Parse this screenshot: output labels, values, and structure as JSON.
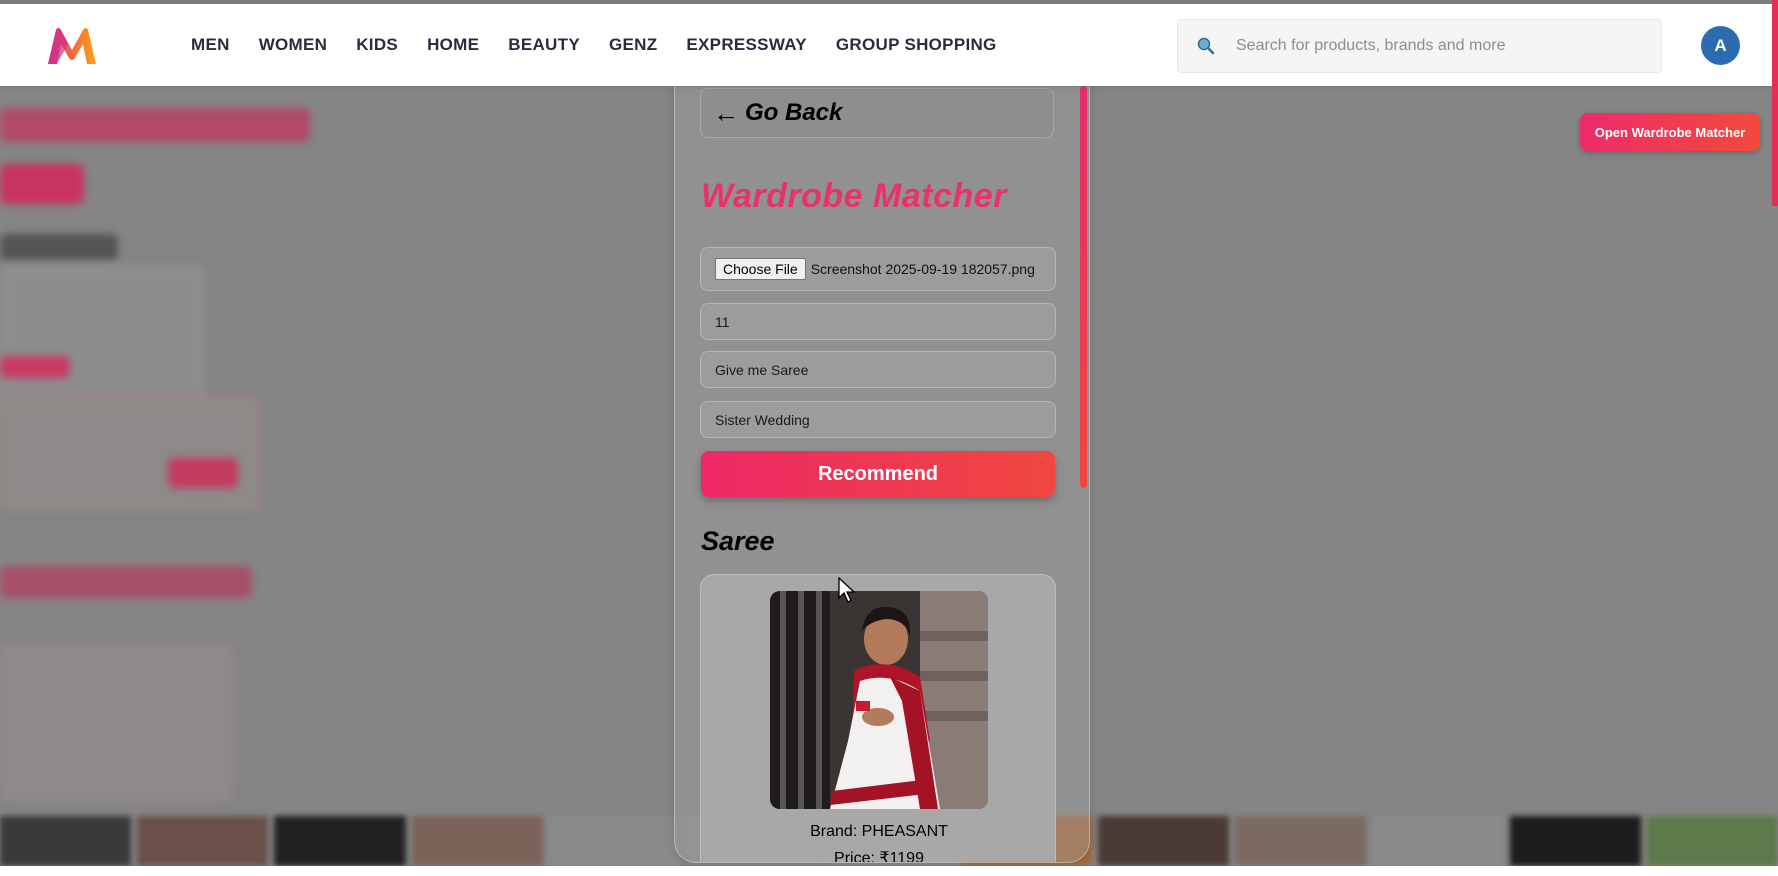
{
  "header": {
    "nav": [
      "MEN",
      "WOMEN",
      "KIDS",
      "HOME",
      "BEAUTY",
      "GENZ",
      "EXPRESSWAY",
      "GROUP SHOPPING"
    ],
    "search_placeholder": "Search for products, brands and more",
    "avatar_initial": "A"
  },
  "open_matcher_label": "Open Wardrobe Matcher",
  "panel": {
    "go_back_label": "Go Back",
    "title": "Wardrobe Matcher",
    "file": {
      "button_label": "Choose File",
      "file_name": "Screenshot 2025-09-19 182057.png"
    },
    "fields": [
      "11",
      "Give me Saree",
      "Sister Wedding"
    ],
    "recommend_label": "Recommend",
    "result_heading": "Saree",
    "product": {
      "brand": "Brand: PHEASANT",
      "price": "Price: ₹1199"
    }
  },
  "colors": {
    "accent": "#e8336a",
    "button_gradient_start": "#ee2866",
    "button_gradient_end": "#f0473f",
    "avatar": "#2b6cb0"
  }
}
